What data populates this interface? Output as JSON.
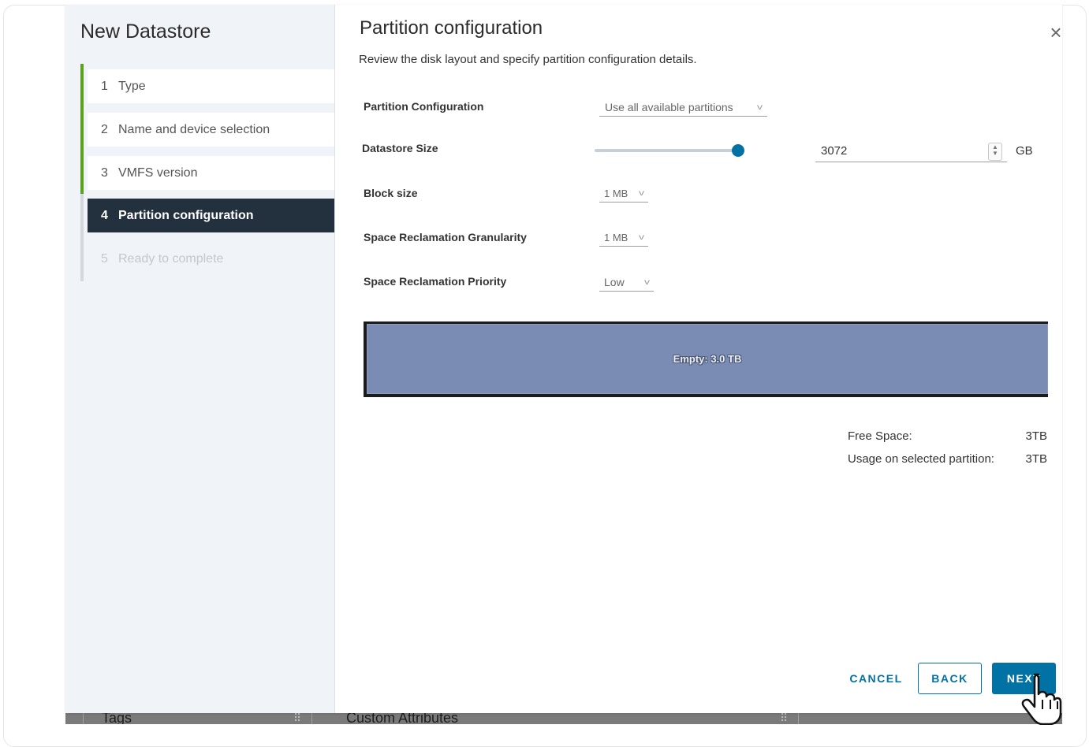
{
  "background": {
    "tabs": [
      "Tags",
      "Custom Attributes"
    ]
  },
  "sidebar": {
    "title": "New Datastore",
    "steps": [
      {
        "num": "1",
        "label": "Type"
      },
      {
        "num": "2",
        "label": "Name and device selection"
      },
      {
        "num": "3",
        "label": "VMFS version"
      },
      {
        "num": "4",
        "label": "Partition configuration"
      },
      {
        "num": "5",
        "label": "Ready to complete"
      }
    ]
  },
  "main": {
    "title": "Partition configuration",
    "subtitle": "Review the disk layout and specify partition configuration details.",
    "fields": {
      "partition_configuration": {
        "label": "Partition Configuration",
        "value": "Use all available partitions"
      },
      "datastore_size": {
        "label": "Datastore Size",
        "value": "3072",
        "unit": "GB",
        "slider_fraction": 1.0
      },
      "block_size": {
        "label": "Block size",
        "value": "1 MB"
      },
      "reclamation_granularity": {
        "label": "Space Reclamation Granularity",
        "value": "1 MB"
      },
      "reclamation_priority": {
        "label": "Space Reclamation Priority",
        "value": "Low"
      }
    },
    "disk_layout": {
      "label": "Empty: 3.0 TB",
      "color": "#7a8cb3"
    },
    "summary": {
      "free_space_label": "Free Space:",
      "free_space_value": "3TB",
      "usage_label": "Usage on selected partition:",
      "usage_value": "3TB"
    },
    "buttons": {
      "cancel": "CANCEL",
      "back": "BACK",
      "next": "NEXT"
    }
  },
  "colors": {
    "accent": "#0072a3",
    "active_step": "#23313f",
    "completed_rail": "#5aa220"
  },
  "icons": {
    "close": "close-icon",
    "caret": "chevron-down-icon",
    "spinner": "spinner-icon",
    "cursor": "hand-pointer-icon"
  }
}
